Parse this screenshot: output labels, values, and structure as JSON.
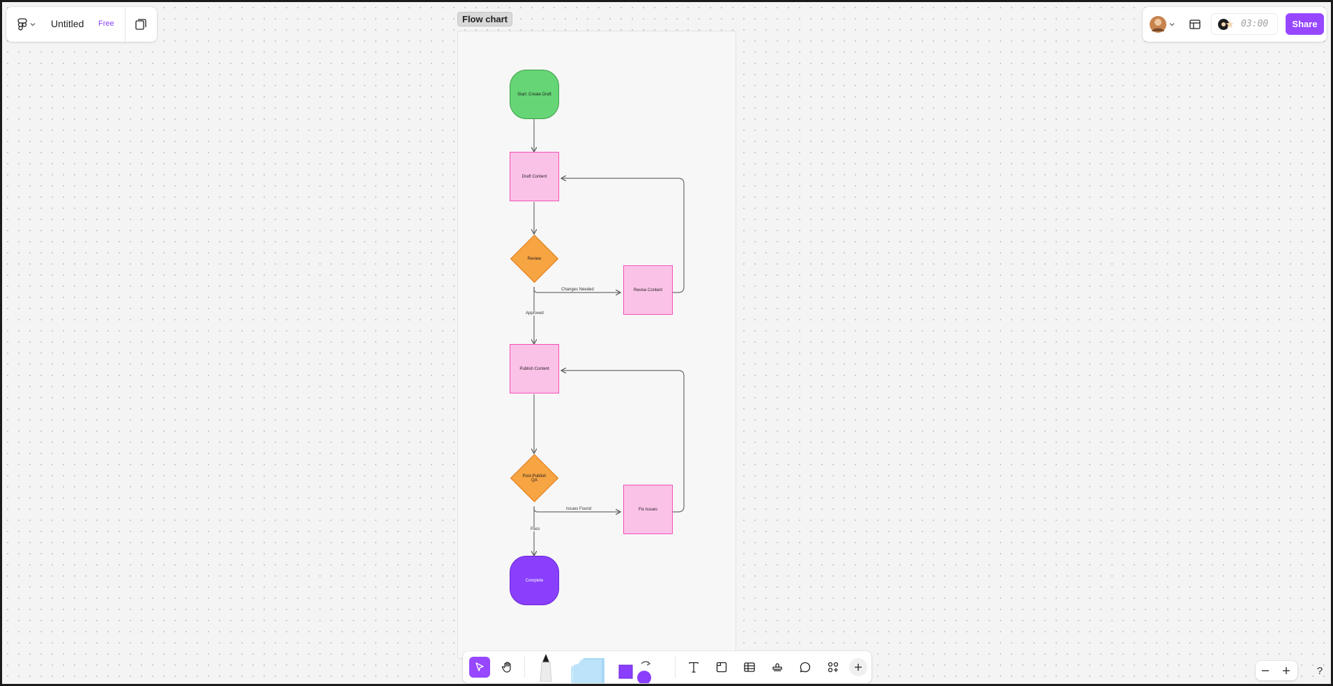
{
  "app": {
    "file_title": "Untitled",
    "plan_badge": "Free",
    "menu_icon": "figma-logo-icon",
    "colors": {
      "accent": "#9747ff",
      "canvas": "#f4f4f4"
    }
  },
  "header_right": {
    "timer": "03:00",
    "share_label": "Share"
  },
  "section": {
    "label": "Flow chart"
  },
  "flow": {
    "start": "Start: Create Draft",
    "draft": "Draft Content",
    "review": "Review",
    "revise": "Revise Content",
    "changes_label": "Changes Needed",
    "approved_label": "Approved",
    "publish": "Publish Content",
    "qa": "Post-Publish QA",
    "fix": "Fix Issues",
    "issues_label": "Issues Found",
    "pass_label": "Pass",
    "complete": "Complete",
    "colors": {
      "start": "#66d575",
      "process": "#fbc2e8",
      "decision": "#f7a442",
      "end": "#8a3ffc"
    }
  },
  "toolbar": {
    "tools": [
      "move-tool",
      "hand-tool",
      "pen-tool",
      "sticky-note-tool",
      "shape-tool",
      "text-tool",
      "section-tool",
      "table-tool",
      "stamp-tool",
      "comment-tool",
      "more-tools",
      "add-tool"
    ]
  },
  "zoom": {
    "help": "?"
  }
}
